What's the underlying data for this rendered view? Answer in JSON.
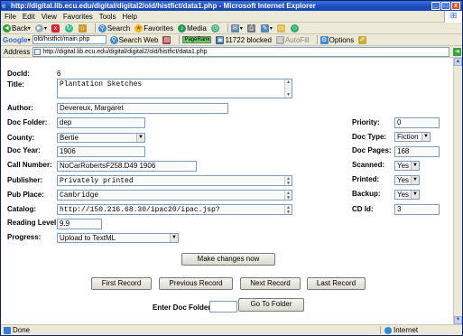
{
  "window": {
    "title": "http://digital.lib.ecu.edu/digital/digital2/old/histfict/data1.php - Microsoft Internet Explorer",
    "controls": [
      "_",
      "□",
      "x"
    ]
  },
  "menu": [
    "File",
    "Edit",
    "View",
    "Favorites",
    "Tools",
    "Help"
  ],
  "toolbar": {
    "back": "Back",
    "search": "Search",
    "favorites": "Favorites",
    "media": "Media"
  },
  "google_bar": {
    "label": "Google",
    "url_value": "old/histfict/main.php",
    "search_web": "Search Web",
    "pagerank": "PageRank",
    "blocked": "11722 blocked",
    "autofill": "AutoFill",
    "options": "Options"
  },
  "address": {
    "label": "Address",
    "url": "http://digital.lib.ecu.edu/digital/digital2/old/histfict/data1.php",
    "go": "Go"
  },
  "form": {
    "docid_label": "DocId:",
    "docid_value": "6",
    "title_label": "Title:",
    "title_value": "Plantation Sketches",
    "author_label": "Author:",
    "author_value": "Devereux, Margaret",
    "folder_label": "Doc Folder:",
    "folder_value": "dep",
    "county_label": "County:",
    "county_value": "Bertie",
    "year_label": "Doc Year:",
    "year_value": "1906",
    "call_label": "Call Number:",
    "call_value": "NoCarRobertsF258.D49 1906",
    "publisher_label": "Publisher:",
    "publisher_value": "Privately printed",
    "pubplace_label": "Pub Place:",
    "pubplace_value": "Cambridge",
    "catalog_label": "Catalog:",
    "catalog_value": "http://150.216.68.30/ipac20/ipac.jsp?",
    "reading_label": "Reading Level:",
    "reading_value": "9.9",
    "progress_label": "Progress:",
    "progress_value": "Upload to TextML",
    "priority_label": "Priority:",
    "priority_value": "0",
    "doctype_label": "Doc Type:",
    "doctype_value": "Fiction",
    "pages_label": "Doc Pages:",
    "pages_value": "168",
    "scanned_label": "Scanned:",
    "scanned_value": "Yes",
    "printed_label": "Printed:",
    "printed_value": "Yes",
    "backup_label": "Backup:",
    "backup_value": "Yes",
    "cdid_label": "CD Id:",
    "cdid_value": "3"
  },
  "buttons": {
    "make_changes": "Make changes now",
    "first": "First Record",
    "previous": "Previous Record",
    "next": "Next Record",
    "last": "Last Record",
    "enter_folder_label": "Enter Doc Folder:",
    "go_folder": "Go To Folder"
  },
  "status": {
    "text": "Done",
    "zone": "Internet"
  }
}
